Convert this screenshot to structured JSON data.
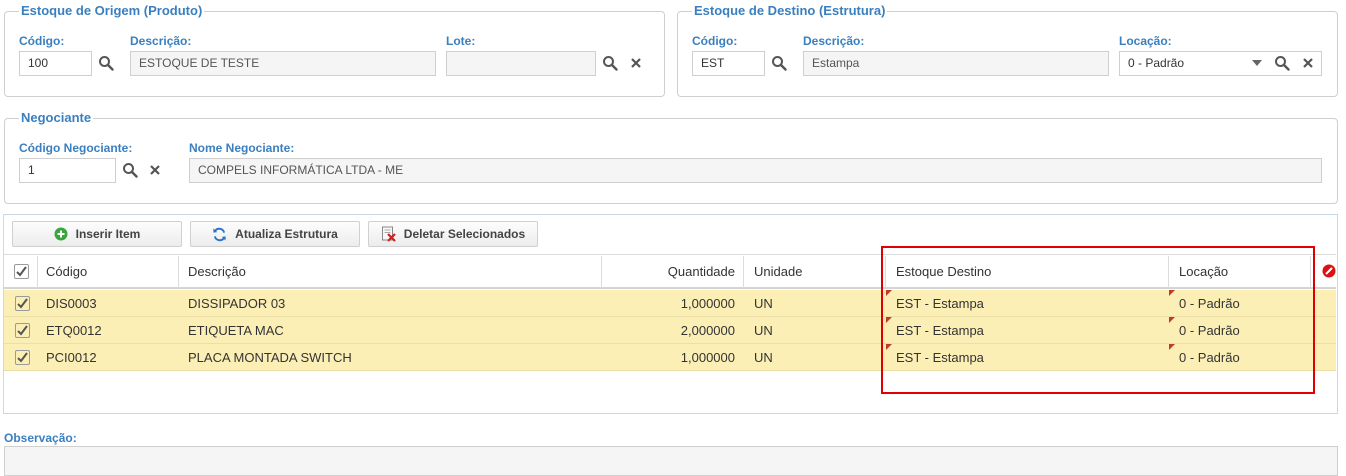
{
  "origem": {
    "legend": "Estoque de Origem (Produto)",
    "codigo_label": "Código:",
    "codigo_value": "100",
    "descricao_label": "Descrição:",
    "descricao_value": "ESTOQUE DE TESTE",
    "lote_label": "Lote:",
    "lote_value": ""
  },
  "destino": {
    "legend": "Estoque de Destino (Estrutura)",
    "codigo_label": "Código:",
    "codigo_value": "EST",
    "descricao_label": "Descrição:",
    "descricao_value": "Estampa",
    "locacao_label": "Locação:",
    "locacao_value": "0 - Padrão"
  },
  "negociante": {
    "legend": "Negociante",
    "codigo_label": "Código Negociante:",
    "codigo_value": "1",
    "nome_label": "Nome Negociante:",
    "nome_value": "COMPELS INFORMÁTICA LTDA - ME"
  },
  "toolbar": {
    "insert_label": "Inserir Item",
    "update_label": "Atualiza Estrutura",
    "delete_label": "Deletar Selecionados"
  },
  "grid": {
    "columns": [
      "Código",
      "Descrição",
      "Quantidade",
      "Unidade",
      "Estoque Destino",
      "Locação"
    ],
    "rows": [
      {
        "codigo": "DIS0003",
        "descricao": "DISSIPADOR 03",
        "quantidade": "1,000000",
        "unidade": "UN",
        "estoque_destino": "EST - Estampa",
        "locacao": "0 - Padrão"
      },
      {
        "codigo": "ETQ0012",
        "descricao": "ETIQUETA MAC",
        "quantidade": "2,000000",
        "unidade": "UN",
        "estoque_destino": "EST - Estampa",
        "locacao": "0 - Padrão"
      },
      {
        "codigo": "PCI0012",
        "descricao": "PLACA MONTADA SWITCH",
        "quantidade": "1,000000",
        "unidade": "UN",
        "estoque_destino": "EST - Estampa",
        "locacao": "0 - Padrão"
      }
    ]
  },
  "observacao": {
    "label": "Observação:",
    "value": ""
  },
  "colors": {
    "accent": "#3a7fbf",
    "row_highlight": "#fcefb6",
    "annotation_red": "#e00000",
    "dirty_marker": "#c0392b"
  }
}
